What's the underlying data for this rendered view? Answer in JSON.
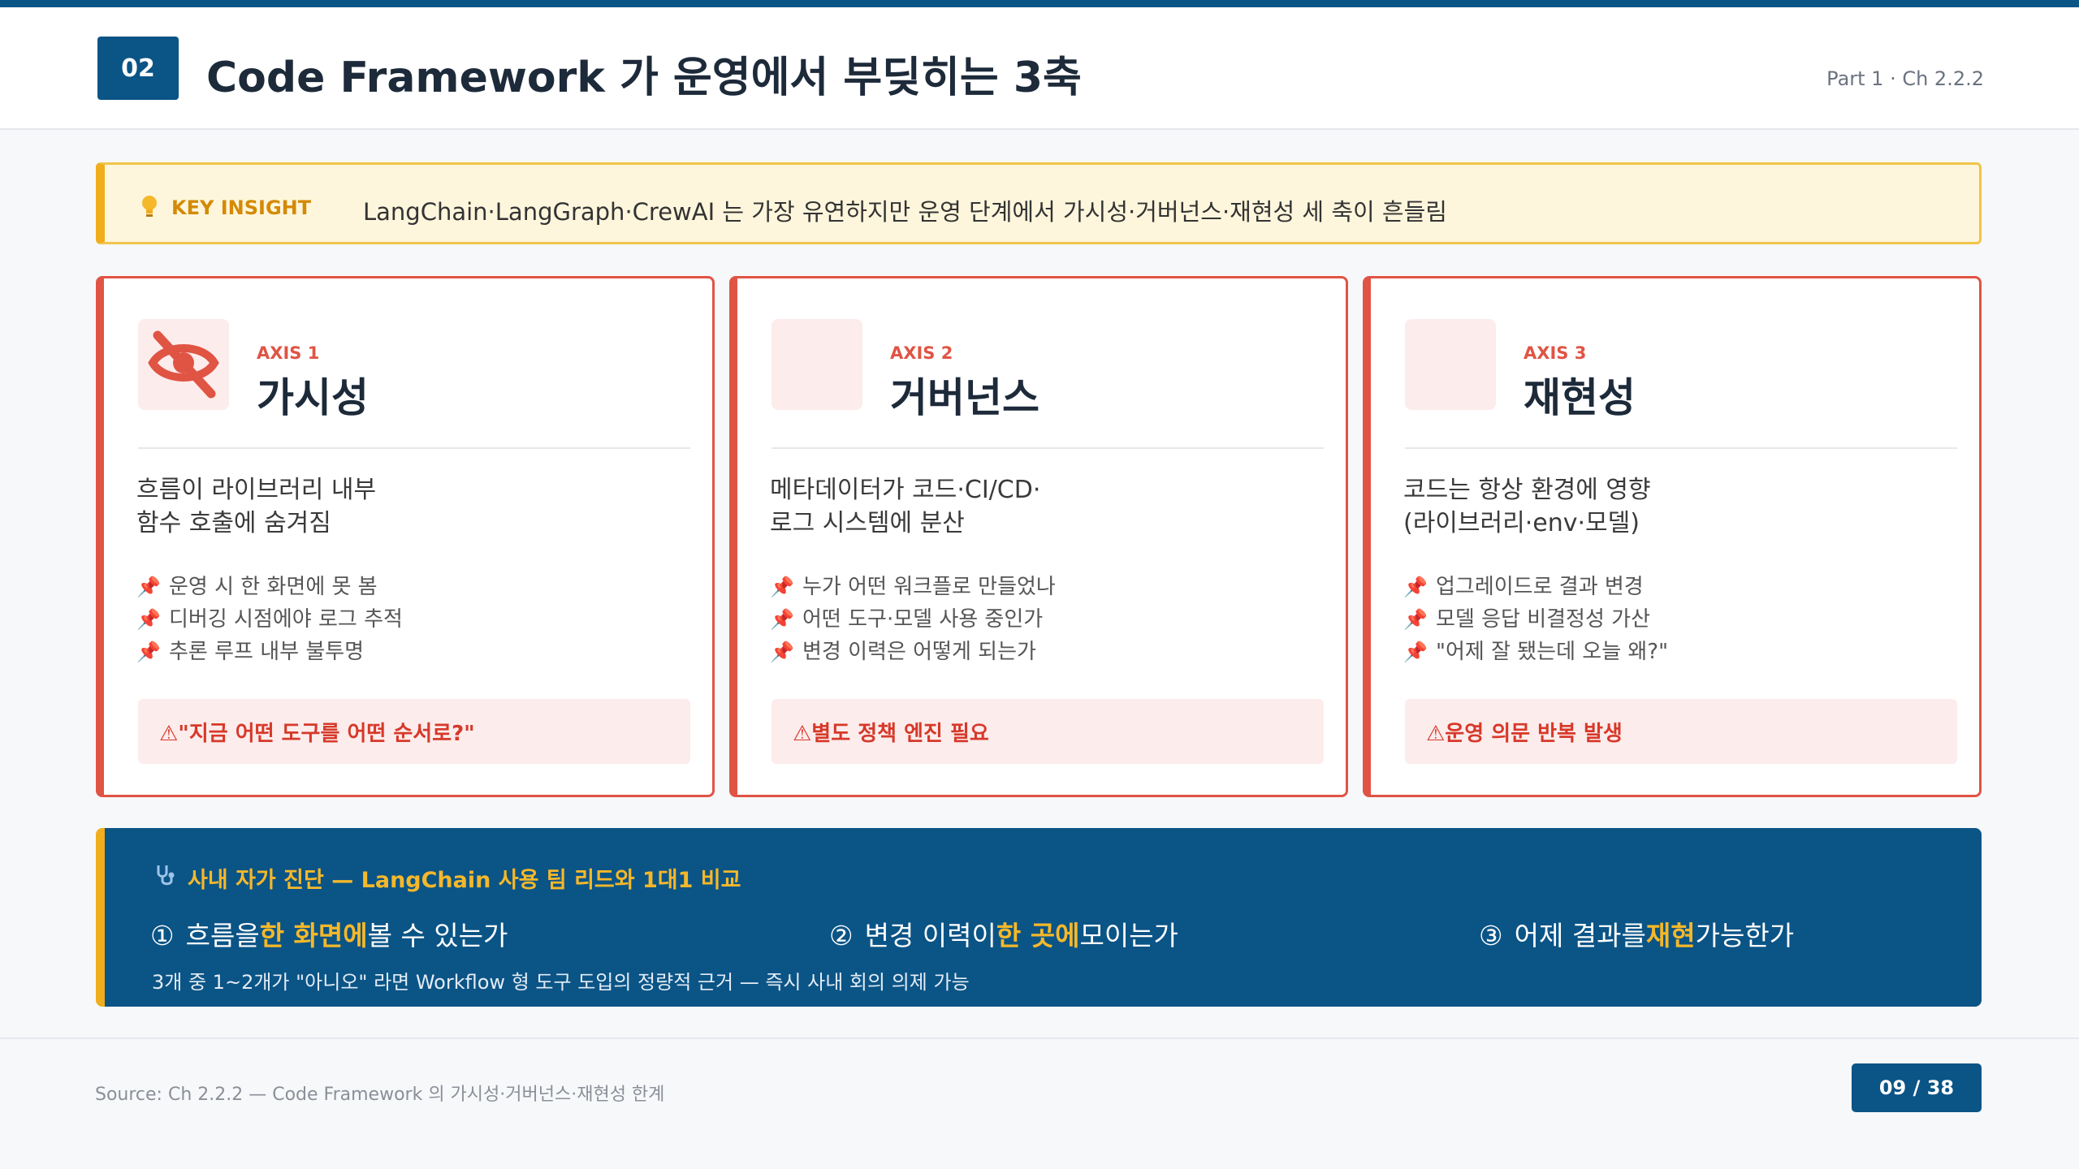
{
  "header": {
    "section_number": "02",
    "title": "Code Framework 가 운영에서 부딪히는 3축",
    "part_label": "Part 1 · Ch 2.2.2"
  },
  "insight": {
    "icon": "lightbulb-icon",
    "label": "KEY INSIGHT",
    "text": "LangChain·LangGraph·CrewAI 는 가장 유연하지만 운영 단계에서 가시성·거버넌스·재현성 세 축이 흔들림"
  },
  "axes": [
    {
      "axis_label": "AXIS 1",
      "title": "가시성",
      "icon": "eye-off-icon",
      "desc": [
        "흐름이 라이브러리 내부",
        "함수 호출에 숨겨짐"
      ],
      "bullets": [
        "운영 시 한 화면에 못 봄",
        "디버깅 시점에야 로그 추적",
        "추론 루프 내부 불투명"
      ],
      "warning": "⚠\"지금 어떤 도구를 어떤 순서로?\""
    },
    {
      "axis_label": "AXIS 2",
      "title": "거버넌스",
      "icon": "",
      "desc": [
        "메타데이터가 코드·CI/CD·",
        "로그 시스템에 분산"
      ],
      "bullets": [
        "누가 어떤 워크플로 만들었나",
        "어떤 도구·모델 사용 중인가",
        "변경 이력은 어떻게 되는가"
      ],
      "warning": "⚠별도 정책 엔진 필요"
    },
    {
      "axis_label": "AXIS 3",
      "title": "재현성",
      "icon": "",
      "desc": [
        "코드는 항상 환경에 영향",
        "(라이브러리·env·모델)"
      ],
      "bullets": [
        "업그레이드로 결과 변경",
        "모델 응답 비결정성 가산",
        "\"어제 잘 됐는데 오늘 왜?\""
      ],
      "warning": "⚠운영 의문 반복 발생"
    }
  ],
  "diagnosis": {
    "title": "사내 자가 진단 — LangChain 사용 팀 리드와 1대1 비교",
    "questions": [
      {
        "num": "①",
        "pre": "흐름을",
        "hl": "한 화면에",
        "post": "볼 수 있는가"
      },
      {
        "num": "②",
        "pre": "변경 이력이",
        "hl": "한 곳에",
        "post": "모이는가"
      },
      {
        "num": "③",
        "pre": "어제 결과를",
        "hl": "재현",
        "post": "가능한가"
      }
    ],
    "note": "3개 중 1~2개가 \"아니오\" 라면 Workflow 형 도구 도입의 정량적 근거 — 즉시 사내 회의 의제 가능"
  },
  "footer": {
    "source": "Source: Ch 2.2.2 — Code Framework 의 가시성·거버넌스·재현성 한계",
    "page": "09 / 38"
  },
  "colors": {
    "brand": "#0b5486",
    "accent_red": "#e05444",
    "accent_yellow": "#f0ad1e",
    "highlight": "#f5b82a"
  }
}
